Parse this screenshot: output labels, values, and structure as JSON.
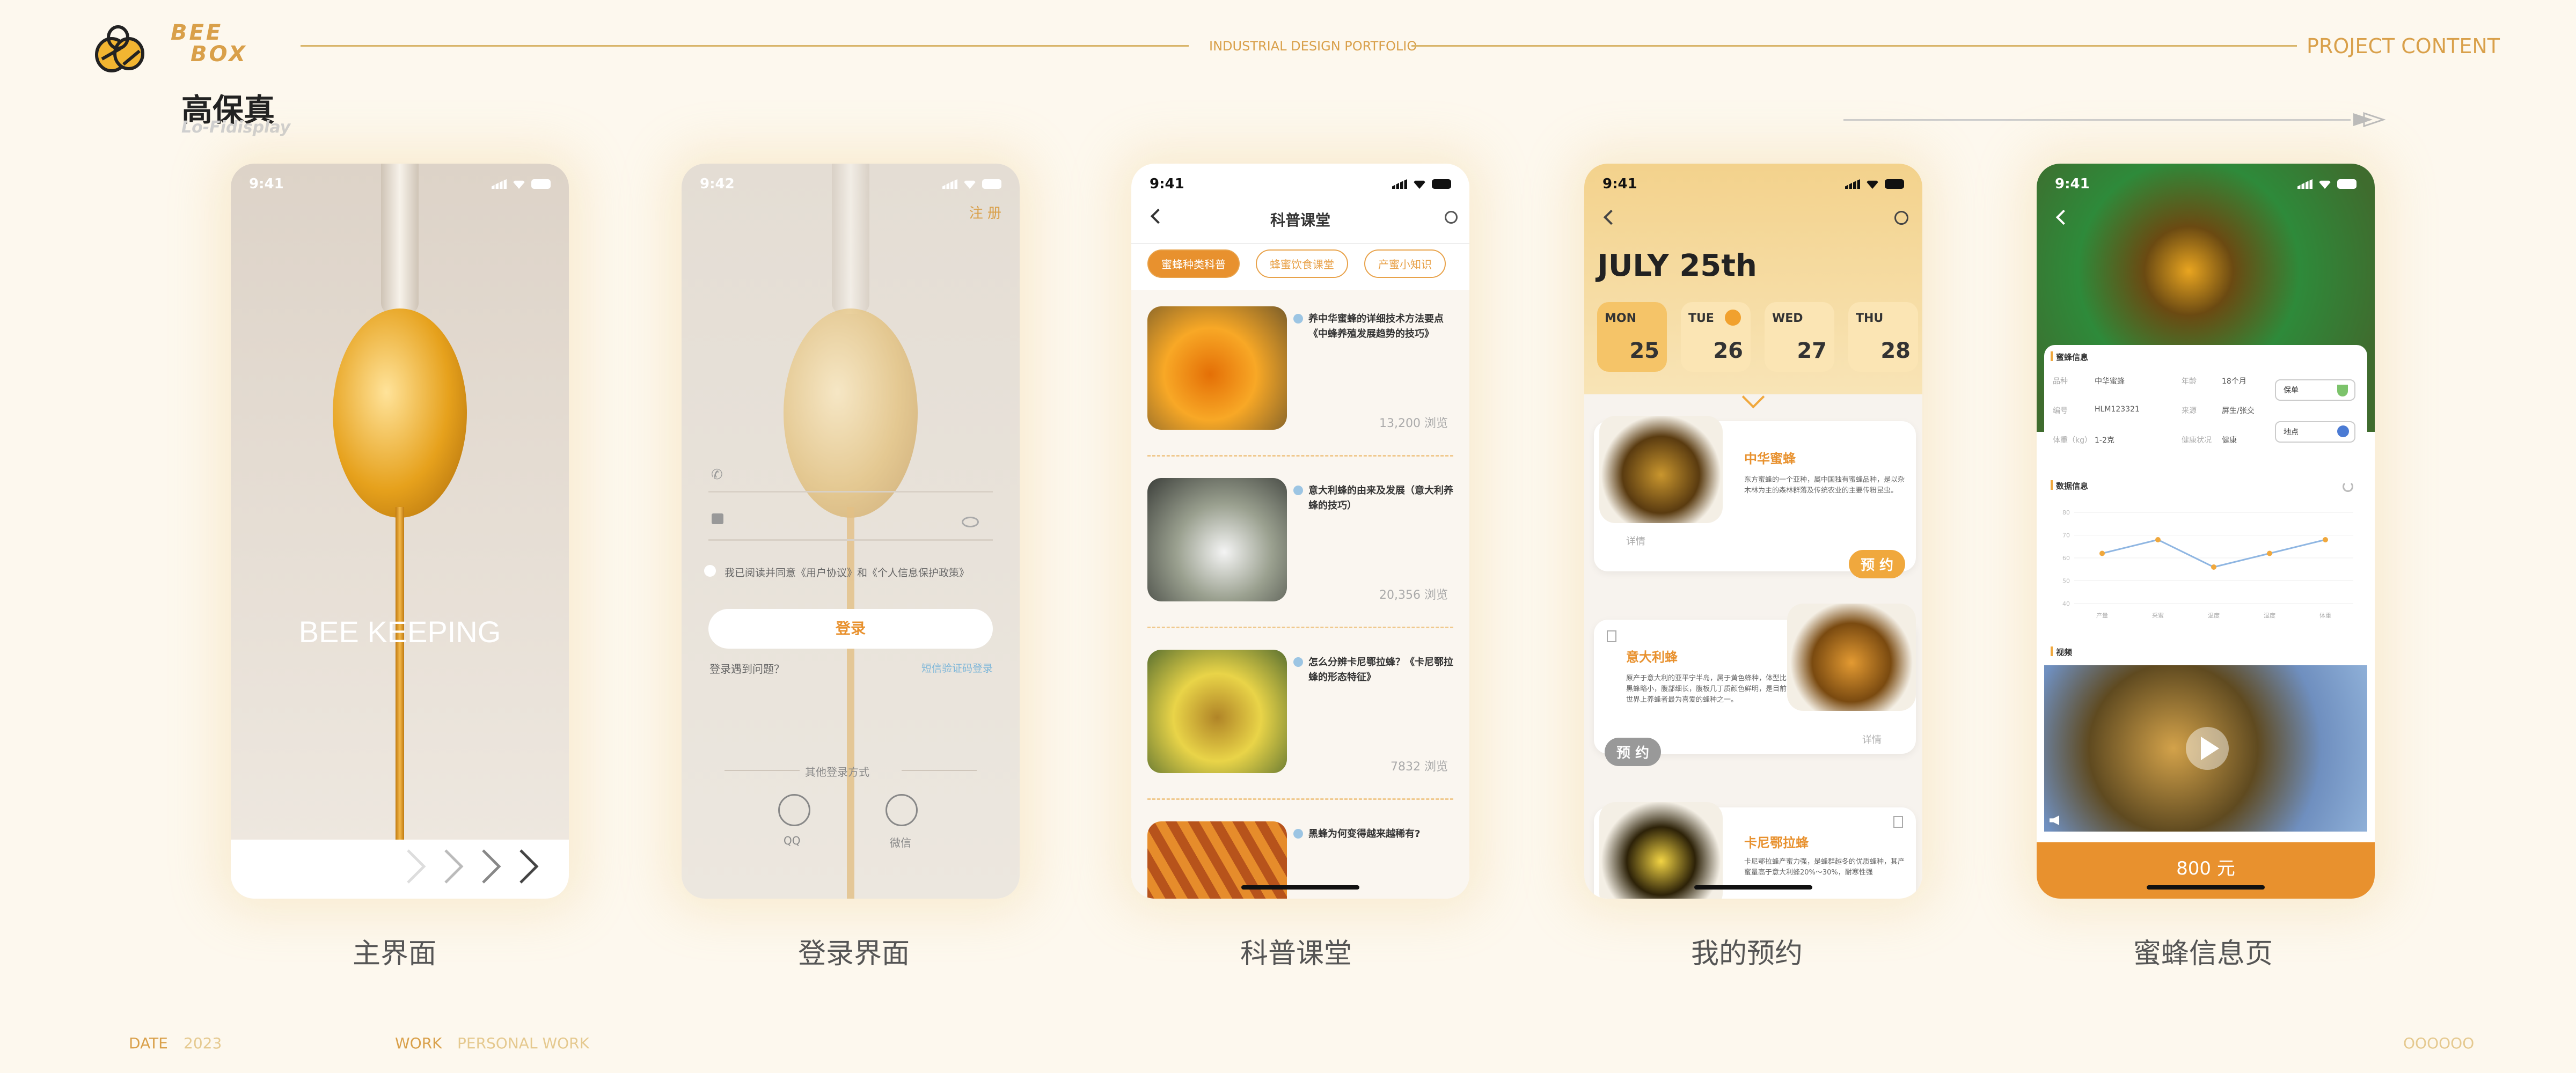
{
  "header": {
    "brand_line1": "BEE",
    "brand_line2": "BOX",
    "center_title": "INDUSTRIAL DESIGN PORTFOLIO",
    "right_title": "PROJECT CONTENT",
    "page_title": "高保真",
    "page_subtitle": "Lo-Fidisplay"
  },
  "footer": {
    "date_label": "DATE",
    "date_value": "2023",
    "work_label": "WORK",
    "work_value": "PERSONAL WORK",
    "page_dots": "OOOOOO"
  },
  "screens": [
    {
      "label": "主界面",
      "time": "9:41",
      "hero_text": "BEE KEEPING"
    },
    {
      "label": "登录界面",
      "time": "9:42",
      "register": "注 册",
      "agreement": "我已阅读并同意《用户协议》和《个人信息保护政策》",
      "login_button": "登录",
      "login_problem": "登录遇到问题？",
      "code_login": "短信验证码登录",
      "other_login": "其他登录方式",
      "qq": "QQ",
      "wechat": "微信"
    },
    {
      "label": "科普课堂",
      "time": "9:41",
      "title": "科普课堂",
      "tabs": [
        "蜜蜂种类科普",
        "蜂蜜饮食课堂",
        "产蜜小知识"
      ],
      "articles": [
        {
          "title": "养中华蜜蜂的详细技术方法要点《中蜂养殖发展趋势的技巧》",
          "views": "13,200 浏览"
        },
        {
          "title": "意大利蜂的由来及发展（意大利养蜂的技巧）",
          "views": "20,356 浏览"
        },
        {
          "title": "怎么分辨卡尼鄂拉蜂？《卡尼鄂拉蜂的形态特征》",
          "views": "7832 浏览"
        },
        {
          "title": "黑蜂为何变得越来越稀有?",
          "views": ""
        }
      ]
    },
    {
      "label": "我的预约",
      "time": "9:41",
      "date_title": "JULY 25th",
      "days": [
        {
          "d": "MON",
          "n": "25"
        },
        {
          "d": "TUE",
          "n": "26"
        },
        {
          "d": "WED",
          "n": "27"
        },
        {
          "d": "THU",
          "n": "28"
        }
      ],
      "bees": [
        {
          "name": "中华蜜蜂",
          "desc": "东方蜜蜂的一个亚种，属中国独有蜜蜂品种，是以杂木林为主的森林群落及传统农业的主要传粉昆虫。",
          "detail": "详情",
          "btn": "预 约"
        },
        {
          "name": "意大利蜂",
          "desc": "原产于意大利的亚平宁半岛，属于黄色蜂种，体型比黑蜂略小，腹部细长，腹板几丁质颜色鲜明，是目前世界上养蜂者最为喜爱的蜂种之一。",
          "detail": "详情",
          "btn": "预 约"
        },
        {
          "name": "卡尼鄂拉蜂",
          "desc": "卡尼鄂拉蜂产蜜力强，是蜂群越冬的优质蜂种，其产蜜量高于意大利蜂20%～30%，耐寒性强"
        }
      ]
    },
    {
      "label": "蜜蜂信息页",
      "time": "9:41",
      "info_title": "蜜蜂信息",
      "info": [
        {
          "k": "品种",
          "v": "中华蜜蜂"
        },
        {
          "k": "年龄",
          "v": "18个月"
        },
        {
          "k": "编号",
          "v": "HLM123321"
        },
        {
          "k": "来源",
          "v": "屏生/张交"
        },
        {
          "k": "体重（kg）",
          "v": "1-2克"
        },
        {
          "k": "健康状况",
          "v": "健康"
        }
      ],
      "tag1": "保单",
      "tag2": "地点",
      "data_title": "数据信息",
      "video_title": "视频",
      "price": "800 元"
    }
  ],
  "chart_data": {
    "type": "line",
    "x": [
      "产量",
      "采蜜",
      "温度",
      "湿度",
      "体重"
    ],
    "series": [
      {
        "values": [
          62,
          68,
          56,
          62,
          68
        ]
      }
    ],
    "ylim": [
      40,
      80
    ],
    "ylabels": [
      "80",
      "70",
      "60",
      "50",
      "40"
    ],
    "grid": true
  }
}
